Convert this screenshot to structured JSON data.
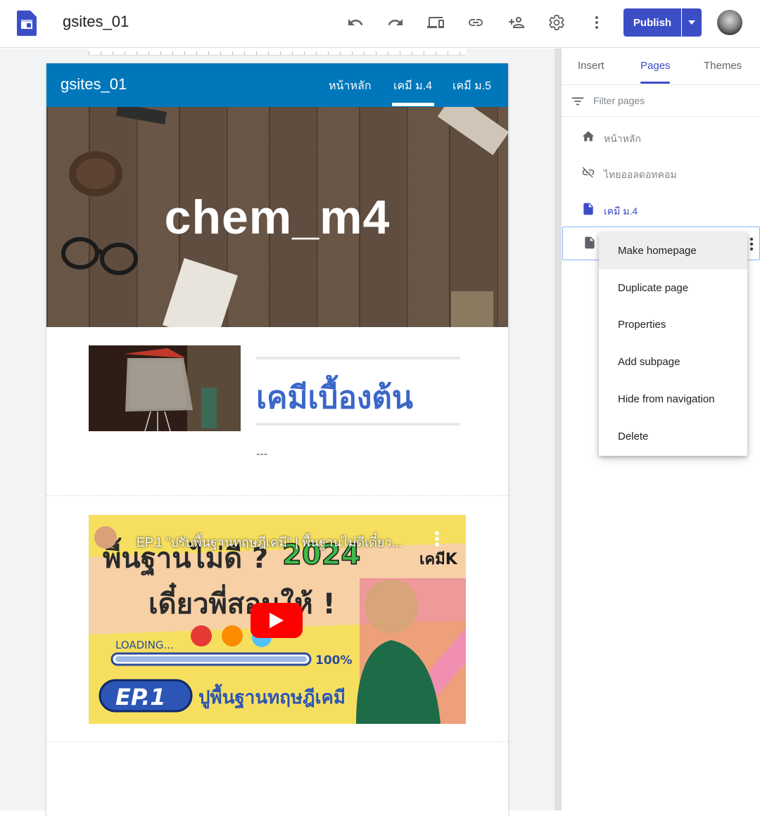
{
  "app": {
    "doc_title": "gsites_01",
    "toolbar": {
      "undo_icon": "undo-icon",
      "redo_icon": "redo-icon",
      "preview_icon": "devices-preview-icon",
      "link_icon": "link-icon",
      "share_icon": "add-person-icon",
      "settings_icon": "gear-icon",
      "more_icon": "more-vert-icon",
      "publish_label": "Publish"
    }
  },
  "site": {
    "name": "gsites_01",
    "nav": [
      "หน้าหลัก",
      "เคมี ม.4",
      "เคมี ม.5"
    ],
    "hero_title": "chem_m4",
    "section_heading": "เคมีเบื้องต้น",
    "section_text": "---",
    "video_title": "EP.1 \"ปรับพื้นฐานทฤษฎีเคมี\" | พื้นฐานไม่ดีเดี๋ยว..."
  },
  "panel": {
    "tabs": [
      "Insert",
      "Pages",
      "Themes"
    ],
    "active_tab": "Pages",
    "filter_placeholder": "Filter pages",
    "pages": [
      {
        "label": "หน้าหลัก",
        "icon": "home-icon"
      },
      {
        "label": "ไทยออลดอทคอม",
        "icon": "link-off-icon"
      },
      {
        "label": "เคมี ม.4",
        "icon": "page-icon"
      },
      {
        "label": "",
        "icon": "page-icon"
      }
    ]
  },
  "context_menu": {
    "items": [
      "Make homepage",
      "Duplicate page",
      "Properties",
      "Add subpage",
      "Hide from navigation",
      "Delete"
    ]
  },
  "colors": {
    "accent": "#3c4ec6",
    "site_header": "#0077bb",
    "heading": "#3a67c8"
  }
}
